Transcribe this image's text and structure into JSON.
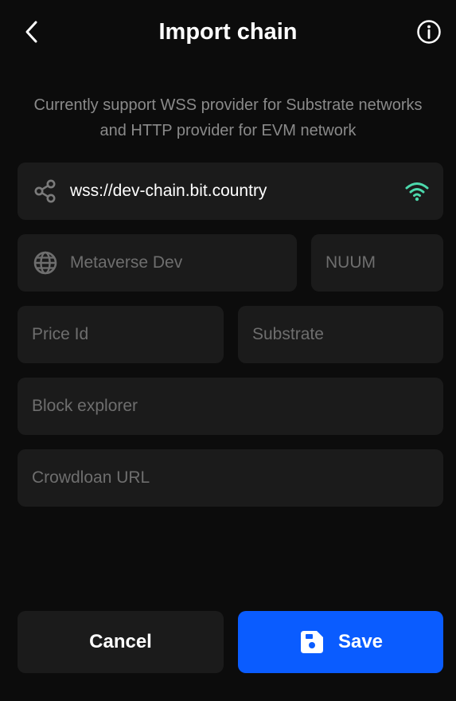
{
  "header": {
    "title": "Import chain"
  },
  "subtitle": "Currently support WSS provider for Substrate networks and HTTP provider for EVM network",
  "form": {
    "provider": {
      "value": "wss://dev-chain.bit.country"
    },
    "network_name": {
      "placeholder": "Metaverse Dev"
    },
    "symbol": {
      "placeholder": "NUUM"
    },
    "price_id": {
      "placeholder": "Price Id"
    },
    "chain_type": {
      "placeholder": "Substrate"
    },
    "block_explorer": {
      "placeholder": "Block explorer"
    },
    "crowdloan_url": {
      "placeholder": "Crowdloan URL"
    }
  },
  "actions": {
    "cancel_label": "Cancel",
    "save_label": "Save"
  },
  "colors": {
    "background": "#0c0c0c",
    "field": "#1b1b1b",
    "primary": "#0a5cff",
    "connected": "#4cd9ac",
    "muted_text": "#8a8a8a"
  },
  "icons": [
    "chevron-left-icon",
    "info-icon",
    "share-icon",
    "wifi-icon",
    "globe-icon",
    "save-icon"
  ]
}
